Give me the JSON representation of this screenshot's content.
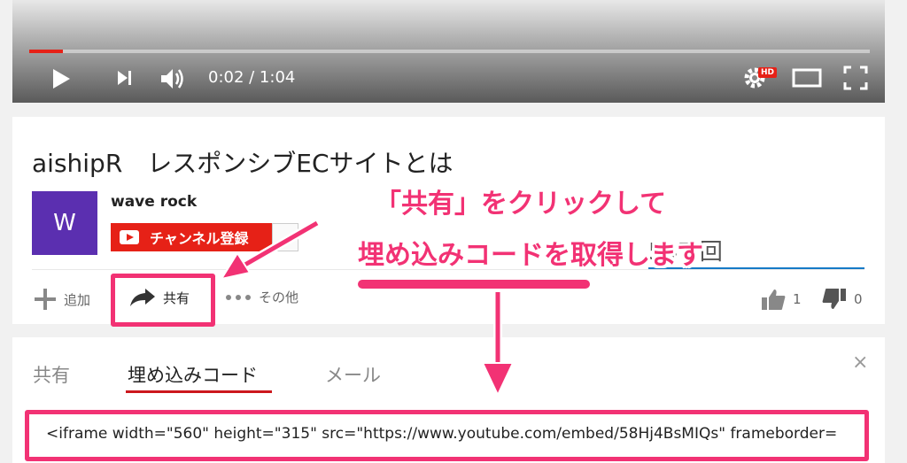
{
  "player": {
    "time": "0:02 / 1:04",
    "progress_fraction": 0.04,
    "hd_badge": "HD",
    "icons": [
      "play-icon",
      "next-icon",
      "volume-icon",
      "settings-icon",
      "theater-mode-icon",
      "fullscreen-icon"
    ]
  },
  "video": {
    "title": "aishipR　レスポンシブECサイトとは",
    "channel_name": "wave rock",
    "avatar_letter": "W",
    "subscribe_label": "チャンネル登録",
    "views": "547 回"
  },
  "actions": {
    "add_label": "追加",
    "share_label": "共有",
    "more_label": "その他",
    "like_count": "1",
    "dislike_count": "0"
  },
  "share_panel": {
    "tabs": [
      "共有",
      "埋め込みコード",
      "メール"
    ],
    "active_tab": "埋め込みコード",
    "close_symbol": "×",
    "embed_code": "<iframe width=\"560\" height=\"315\" src=\"https://www.youtube.com/embed/58Hj4BsMIQs\" frameborder="
  },
  "annotation": {
    "line1": "「共有」をクリックして",
    "line2": "埋め込みコードを取得します",
    "color": "#f23274"
  },
  "colors": {
    "brand_red": "#e62117",
    "avatar_purple": "#5b2fb0",
    "annotation_pink": "#f23274"
  }
}
